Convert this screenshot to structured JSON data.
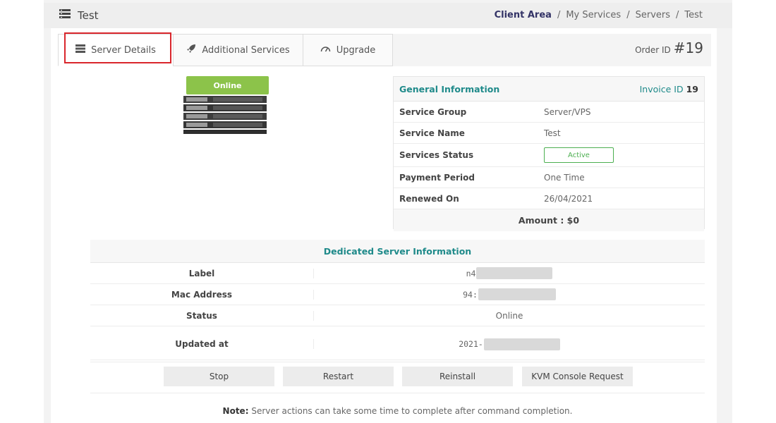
{
  "header": {
    "title": "Test"
  },
  "breadcrumb": {
    "items": [
      "Client Area",
      "My Services",
      "Servers",
      "Test"
    ],
    "separator": "/"
  },
  "tabs": [
    {
      "label": "Server Details",
      "icon": "server-list-icon",
      "active": true
    },
    {
      "label": "Additional Services",
      "icon": "rocket-icon",
      "active": false
    },
    {
      "label": "Upgrade",
      "icon": "gauge-icon",
      "active": false
    }
  ],
  "order": {
    "label": "Order ID",
    "value": "#19"
  },
  "server": {
    "status": "Online",
    "status_color": "#8cc34a"
  },
  "general": {
    "title": "General Information",
    "invoice_label": "Invoice ID",
    "invoice_value": "19",
    "rows": [
      {
        "key": "Service Group",
        "value": "Server/VPS"
      },
      {
        "key": "Service Name",
        "value": "Test"
      },
      {
        "key": "Services Status",
        "value": "Active"
      },
      {
        "key": "Payment Period",
        "value": "One Time"
      },
      {
        "key": "Renewed On",
        "value": "26/04/2021"
      }
    ],
    "amount": "Amount : $0"
  },
  "dedicated": {
    "title": "Dedicated Server Information",
    "rows": [
      {
        "key": "Label",
        "value": "n4"
      },
      {
        "key": "Mac Address",
        "value": "94:"
      },
      {
        "key": "Status",
        "value": "Online"
      },
      {
        "key": "Updated at",
        "value": "2021-"
      }
    ]
  },
  "actions": [
    "Stop",
    "Restart",
    "Reinstall",
    "KVM Console Request"
  ],
  "note": {
    "label": "Note:",
    "text": "Server actions can take some time to complete after command completion."
  },
  "colors": {
    "accent": "#1f8a8a",
    "highlight": "#d9262c",
    "active_badge": "#4caf50"
  }
}
